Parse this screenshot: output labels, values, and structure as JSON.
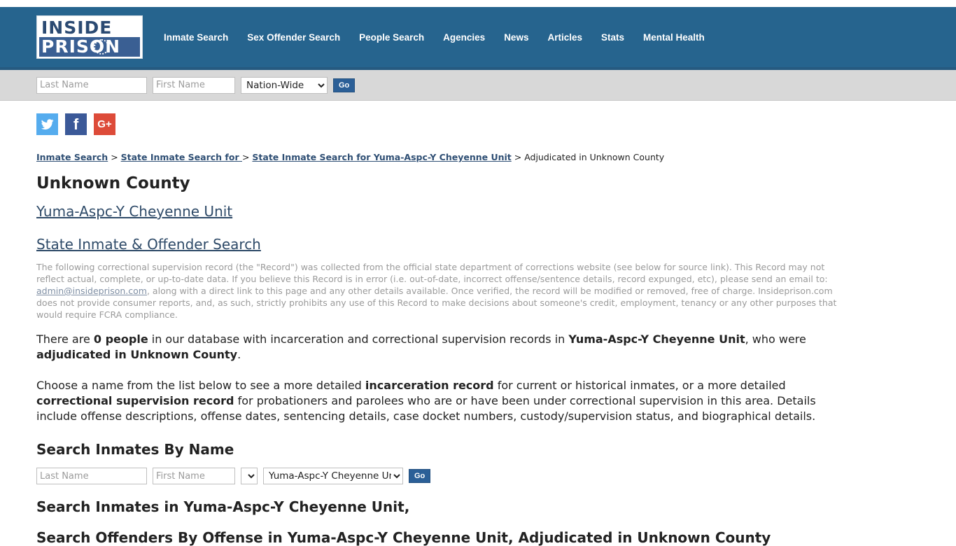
{
  "brand": {
    "logo_line1": "INSIDE",
    "logo_line2": "PRISON",
    "header_color": "#26648e",
    "accent_color": "#2b5f97"
  },
  "nav": {
    "items": [
      {
        "label": "Inmate Search"
      },
      {
        "label": "Sex Offender Search"
      },
      {
        "label": "People Search"
      },
      {
        "label": "Agencies"
      },
      {
        "label": "News"
      },
      {
        "label": "Articles"
      },
      {
        "label": "Stats"
      },
      {
        "label": "Mental Health"
      }
    ]
  },
  "top_search": {
    "last_name_placeholder": "Last Name",
    "last_name_value": "",
    "first_name_placeholder": "First Name",
    "first_name_value": "",
    "scope_selected": "Nation-Wide",
    "go_label": "Go"
  },
  "social": {
    "twitter_glyph": "ᴠ",
    "twitter_label": "t",
    "facebook_label": "f",
    "googleplus_label": "G+",
    "twitter_color": "#55acee",
    "facebook_color": "#3b5998",
    "googleplus_color": "#dd4b39"
  },
  "breadcrumb": {
    "item1": "Inmate Search",
    "item2": "State Inmate Search for ",
    "item3": "State Inmate Search for Yuma-Aspc-Y Cheyenne Unit",
    "current": "Adjudicated in Unknown County",
    "separator": ">"
  },
  "page": {
    "title": "Unknown County",
    "facility_link": "Yuma-Aspc-Y Cheyenne Unit",
    "state_search_link": "State Inmate & Offender Search"
  },
  "disclaimer": {
    "part1": "The following correctional supervision record (the \"Record\") was collected from the official state department of corrections website (see below for source link). This Record may not reflect actual, complete, or up-to-date data. If you believe this Record is in error (i.e. out-of-date, incorrect offense/sentence details, record expunged, etc), please send an email to: ",
    "email": "admin@insideprison.com",
    "part2": ", along with a direct link to this page and any other details available. Once verified, the record will be modified or removed, free of charge. Insideprison.com does not provide consumer reports, and, as such, strictly prohibits any use of this Record to make decisions about someone's credit, employment, tenancy or any other purposes that would require FCRA compliance."
  },
  "count_paragraph": {
    "lead": "There are ",
    "count": "0 people",
    "middle": " in our database with incarceration and correctional supervision records in ",
    "facility": "Yuma-Aspc-Y Cheyenne Unit",
    "comma": ", who were ",
    "adjudication": "adjudicated in Unknown County",
    "period": "."
  },
  "choose_paragraph": {
    "p1": "Choose a name from the list below to see a more detailed ",
    "b1": "incarceration record",
    "p2": " for current or historical inmates, or a more detailed ",
    "b2": "correctional supervision record",
    "p3": " for probationers and parolees who are or have been under correctional supervision in this area. Details include offense descriptions, offense dates, sentencing details, case docket numbers, custody/supervision status, and biographical details."
  },
  "search_by_name": {
    "heading": "Search Inmates By Name",
    "last_name_placeholder": "Last Name",
    "last_name_value": "",
    "first_name_placeholder": "First Name",
    "first_name_value": "",
    "blank_select_value": "",
    "facility_select_value": "Yuma-Aspc-Y Cheyenne Unit",
    "go_label": "Go"
  },
  "lower_sections": {
    "heading_inmates": "Search Inmates in Yuma-Aspc-Y Cheyenne Unit,",
    "heading_offenders": "Search Offenders By Offense in Yuma-Aspc-Y Cheyenne Unit, Adjudicated in Unknown County"
  }
}
